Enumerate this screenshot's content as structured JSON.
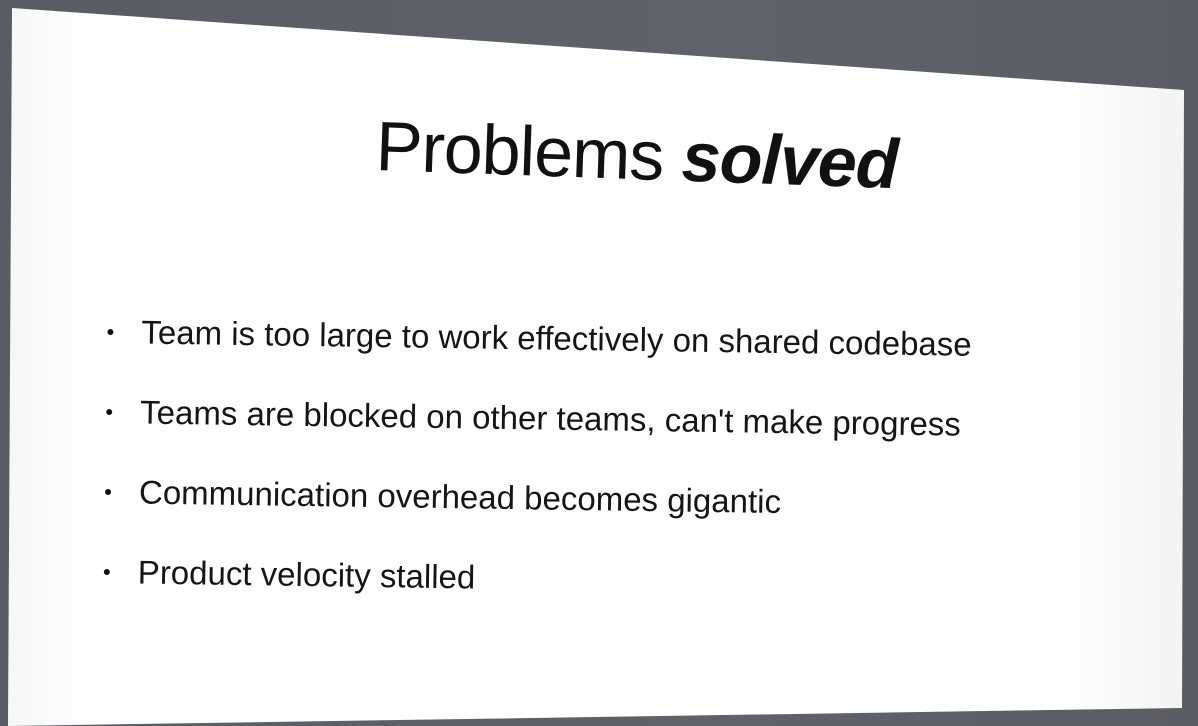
{
  "slide": {
    "title_main": "Problems",
    "title_emphasis": "solved",
    "bullets": [
      "Team is too large to work effectively on shared codebase",
      "Teams are blocked on other teams, can't make progress",
      "Communication overhead becomes gigantic",
      "Product velocity stalled"
    ]
  },
  "colors": {
    "background": "#5d5f66",
    "slide": "#ffffff",
    "text": "#111111"
  }
}
